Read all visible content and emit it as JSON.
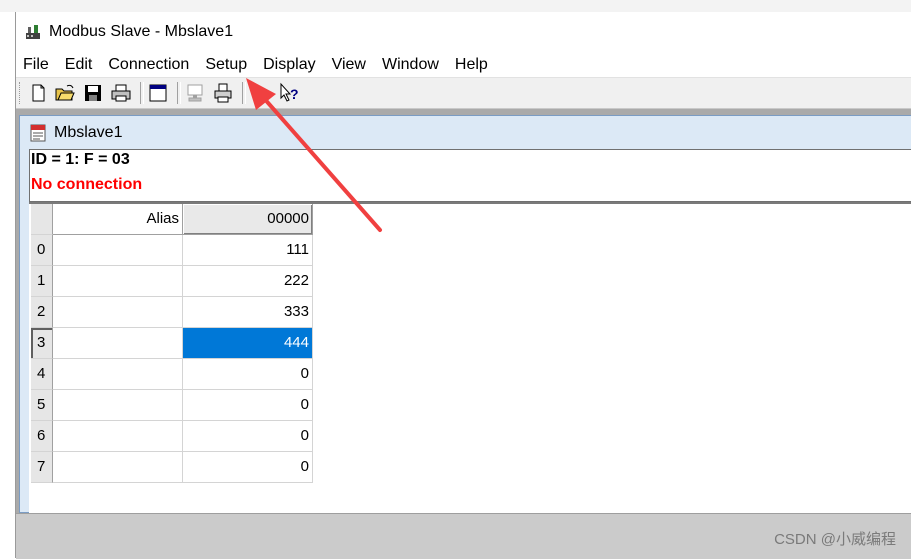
{
  "window": {
    "title": "Modbus Slave - Mbslave1"
  },
  "menu": {
    "items": [
      "File",
      "Edit",
      "Connection",
      "Setup",
      "Display",
      "View",
      "Window",
      "Help"
    ]
  },
  "toolbar": {
    "buttons": [
      "new-icon",
      "open-icon",
      "save-icon",
      "print-icon",
      "window-icon",
      "comm-traffic-icon",
      "print-preview-icon",
      "help-icon"
    ]
  },
  "child_window": {
    "title": "Mbslave1",
    "id_line": "ID = 1: F = 03",
    "status": "No connection"
  },
  "grid": {
    "alias_header": "Alias",
    "value_header": "00000",
    "rows": [
      {
        "index": "0",
        "alias": "",
        "value": "111"
      },
      {
        "index": "1",
        "alias": "",
        "value": "222"
      },
      {
        "index": "2",
        "alias": "",
        "value": "333"
      },
      {
        "index": "3",
        "alias": "",
        "value": "444",
        "selected": true
      },
      {
        "index": "4",
        "alias": "",
        "value": "0"
      },
      {
        "index": "5",
        "alias": "",
        "value": "0"
      },
      {
        "index": "6",
        "alias": "",
        "value": "0"
      },
      {
        "index": "7",
        "alias": "",
        "value": "0"
      }
    ]
  },
  "watermark": "CSDN @小威编程",
  "colors": {
    "selection": "#0078d7",
    "no_connection": "#ff0000",
    "annotation_arrow": "#f04040"
  }
}
